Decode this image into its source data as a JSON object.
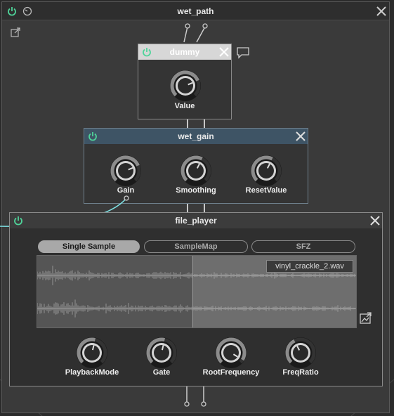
{
  "outer": {
    "title": "wet_path"
  },
  "dummy": {
    "title": "dummy",
    "knob_label": "Value"
  },
  "wet_gain": {
    "title": "wet_gain",
    "knobs": [
      {
        "label": "Gain",
        "level": 0.75
      },
      {
        "label": "Smoothing",
        "level": 0.6
      },
      {
        "label": "ResetValue",
        "level": 0.6
      }
    ]
  },
  "file_player": {
    "title": "file_player",
    "tabs": [
      {
        "label": "Single Sample",
        "active": true
      },
      {
        "label": "SampleMap",
        "active": false
      },
      {
        "label": "SFZ",
        "active": false
      }
    ],
    "filename": "vinyl_crackle_2.wav",
    "knobs": [
      {
        "label": "PlaybackMode",
        "level": 0.55
      },
      {
        "label": "Gate",
        "level": 0.55
      },
      {
        "label": "RootFrequency",
        "level": 0.95
      },
      {
        "label": "FreqRatio",
        "level": 0.4
      }
    ]
  },
  "colors": {
    "power_green": "#4fd49a",
    "wet_gain_header": "#3e5465",
    "cable": "#7fe3e6"
  }
}
